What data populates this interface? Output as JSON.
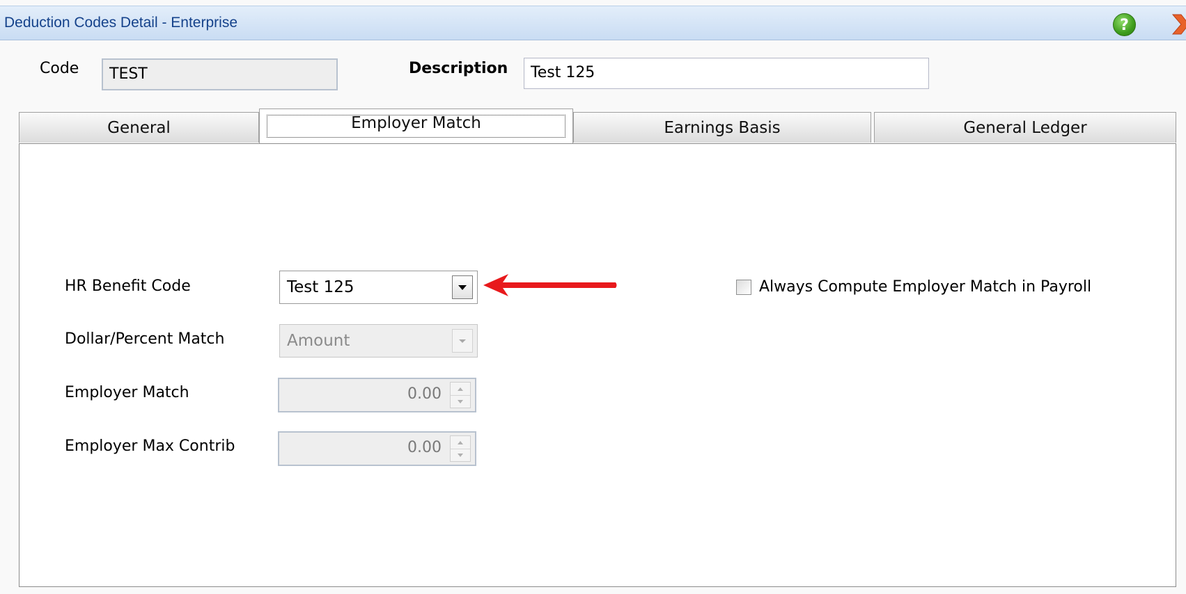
{
  "window": {
    "title": "Deduction Codes Detail - Enterprise",
    "help_glyph": "?"
  },
  "header": {
    "code_label": "Code",
    "code_value": "TEST",
    "description_label": "Description",
    "description_value": "Test 125"
  },
  "tabs": [
    {
      "label": "General",
      "active": false
    },
    {
      "label": "Employer Match",
      "active": true
    },
    {
      "label": "Earnings Basis",
      "active": false
    },
    {
      "label": "General Ledger",
      "active": false
    }
  ],
  "employer_match": {
    "hr_benefit_code_label": "HR Benefit Code",
    "hr_benefit_code_value": "Test 125",
    "dollar_percent_label": "Dollar/Percent Match",
    "dollar_percent_value": "Amount",
    "employer_match_label": "Employer Match",
    "employer_match_value": "0.00",
    "employer_max_label": "Employer Max Contrib",
    "employer_max_value": "0.00",
    "always_compute_label": "Always Compute Employer Match in Payroll",
    "always_compute_checked": false
  },
  "colors": {
    "title_text": "#15428b",
    "annotation_arrow": "#e8191c",
    "help_icon": "#3e9d1d",
    "close_icon": "#e8622a"
  },
  "icons": {
    "help": "help-icon",
    "close": "close-icon",
    "dropdown": "chevron-down-icon",
    "spinner": "spinner-arrows-icon",
    "annotation": "red-arrow-icon"
  }
}
